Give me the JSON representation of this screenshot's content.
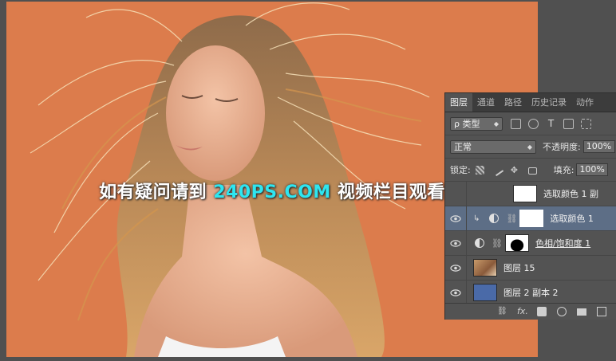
{
  "watermark": {
    "prefix": "如有疑问请到 ",
    "site": "240PS.COM",
    "suffix": " 视频栏目观看视频教程"
  },
  "layers_panel": {
    "tabs": [
      "图层",
      "通道",
      "路径",
      "历史记录",
      "动作"
    ],
    "active_tab": "图层",
    "filter": {
      "label": "ρ 类型"
    },
    "blend_mode": "正常",
    "opacity_label": "不透明度:",
    "opacity_value": "100%",
    "lock_label": "锁定:",
    "fill_label": "填充:",
    "fill_value": "100%",
    "layers": [
      {
        "name": "选取颜色 1 副",
        "visible": false,
        "type": "adjustment",
        "selected": false
      },
      {
        "name": "选取颜色 1",
        "visible": true,
        "type": "adjustment",
        "selected": true
      },
      {
        "name": "色相/饱和度 1",
        "visible": true,
        "type": "adjustment",
        "selected": false
      },
      {
        "name": "图层 15",
        "visible": true,
        "type": "image",
        "selected": false
      },
      {
        "name": "图层 2 副本 2",
        "visible": true,
        "type": "fill",
        "selected": false
      }
    ],
    "bottom_icons": [
      "link-icon",
      "fx-icon",
      "mask-icon",
      "adjustment-icon",
      "folder-icon",
      "new-layer-icon"
    ],
    "bottom_fx_label": "fx."
  },
  "colors": {
    "background_orange": "#dc7c4c",
    "watermark_site": "#2ee6f0",
    "selected_layer": "#5d6e86",
    "fill_layer": "#4a6aa8"
  }
}
